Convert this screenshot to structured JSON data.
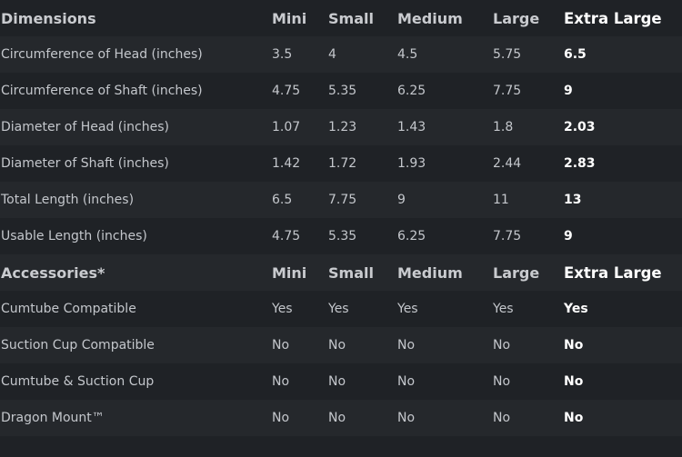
{
  "tables": [
    {
      "header": [
        "Dimensions",
        "Mini",
        "Small",
        "Medium",
        "Large",
        "Extra Large"
      ],
      "rows": [
        [
          "Circumference of Head (inches)",
          "3.5",
          "4",
          "4.5",
          "5.75",
          "6.5"
        ],
        [
          "Circumference of Shaft (inches)",
          "4.75",
          "5.35",
          "6.25",
          "7.75",
          "9"
        ],
        [
          "Diameter of Head (inches)",
          "1.07",
          "1.23",
          "1.43",
          "1.8",
          "2.03"
        ],
        [
          "Diameter of Shaft (inches)",
          "1.42",
          "1.72",
          "1.93",
          "2.44",
          "2.83"
        ],
        [
          "Total Length (inches)",
          "6.5",
          "7.75",
          "9",
          "11",
          "13"
        ],
        [
          "Usable Length (inches)",
          "4.75",
          "5.35",
          "6.25",
          "7.75",
          "9"
        ]
      ]
    },
    {
      "header": [
        "Accessories*",
        "Mini",
        "Small",
        "Medium",
        "Large",
        "Extra Large"
      ],
      "rows": [
        [
          "Cumtube Compatible",
          "Yes",
          "Yes",
          "Yes",
          "Yes",
          "Yes"
        ],
        [
          "Suction Cup Compatible",
          "No",
          "No",
          "No",
          "No",
          "No"
        ],
        [
          "Cumtube & Suction Cup",
          "No",
          "No",
          "No",
          "No",
          "No"
        ],
        [
          "Dragon Mount™",
          "No",
          "No",
          "No",
          "No",
          "No"
        ]
      ]
    }
  ],
  "colors": {
    "background": "#1f2226",
    "row_alt": "#25282c",
    "text": "#c4c7cc",
    "highlight": "#ffffff"
  }
}
